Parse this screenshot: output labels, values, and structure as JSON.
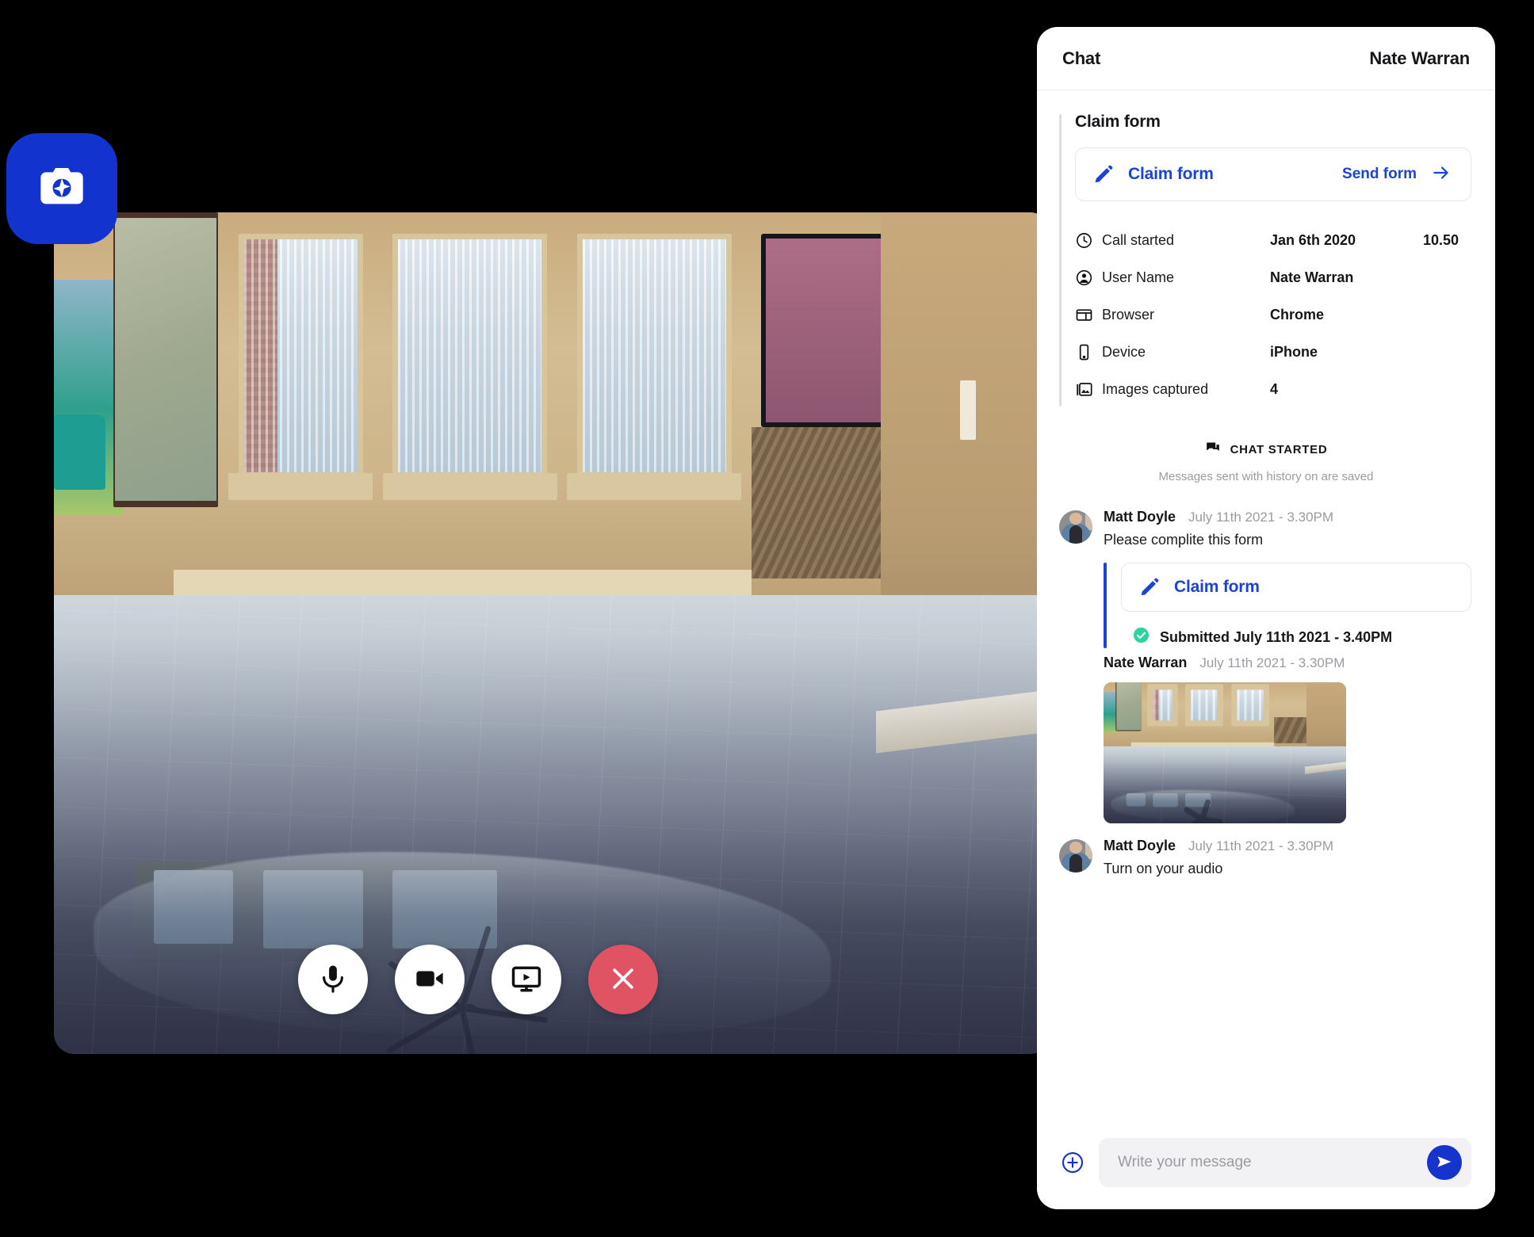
{
  "call": {
    "capture_badge_icon": "camera-sparkle-icon",
    "controls": [
      {
        "name": "microphone",
        "icon": "microphone-icon",
        "style": "light"
      },
      {
        "name": "camera",
        "icon": "video-camera-icon",
        "style": "light"
      },
      {
        "name": "screen-share",
        "icon": "screen-share-icon",
        "style": "light"
      },
      {
        "name": "end-call",
        "icon": "close-icon",
        "style": "danger"
      }
    ]
  },
  "chat": {
    "header": {
      "title": "Chat",
      "peer": "Nate Warran"
    },
    "claim": {
      "section_title": "Claim form",
      "card_label": "Claim form",
      "send_label": "Send form",
      "pencil_icon": "pencil-icon",
      "arrow_icon": "arrow-right-icon"
    },
    "meta": [
      {
        "icon": "clock-icon",
        "label": "Call started",
        "value": "Jan 6th 2020",
        "value2": "10.50"
      },
      {
        "icon": "person-icon",
        "label": "User Name",
        "value": "Nate Warran",
        "value2": ""
      },
      {
        "icon": "browser-icon",
        "label": "Browser",
        "value": "Chrome",
        "value2": ""
      },
      {
        "icon": "phone-icon",
        "label": "Device",
        "value": "iPhone",
        "value2": ""
      },
      {
        "icon": "images-icon",
        "label": "Images captured",
        "value": "4",
        "value2": ""
      }
    ],
    "started": {
      "icon": "chat-bubbles-icon",
      "label": "CHAT STARTED",
      "subtitle": "Messages sent with history on are saved"
    },
    "messages": [
      {
        "author": "Matt Doyle",
        "time": "July 11th 2021 - 3.30PM",
        "text": "Please complite this form",
        "attachment_label": "Claim form",
        "submitted_text": "Submitted July 11th 2021 - 3.40PM"
      },
      {
        "author": "Nate Warran",
        "time": "July 11th 2021 - 3.30PM",
        "text": ""
      },
      {
        "author": "Matt Doyle",
        "time": "July 11th 2021 - 3.30PM",
        "text": "Turn on your audio"
      }
    ],
    "composer": {
      "placeholder": "Write your message",
      "value": "",
      "plus_icon": "plus-circle-icon",
      "send_icon": "send-icon"
    }
  },
  "colors": {
    "brand_blue": "#1434CB",
    "link_blue": "#1A43D8",
    "badge_blue": "#1233CE",
    "danger_red": "#E05362",
    "success_green": "#2DD4A0",
    "muted_gray": "#9A9CA3"
  }
}
